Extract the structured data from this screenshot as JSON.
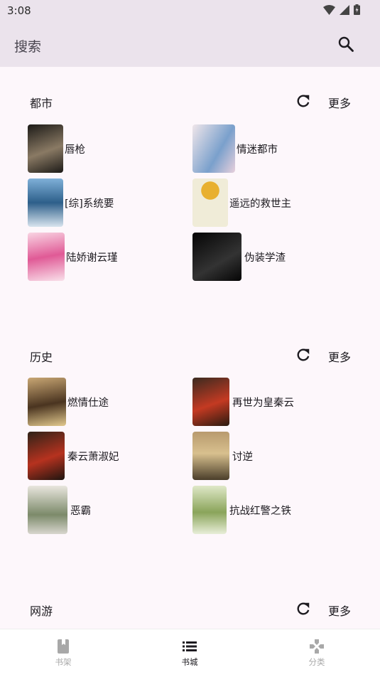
{
  "status": {
    "time": "3:08"
  },
  "appbar": {
    "search_label": "搜索"
  },
  "sections": [
    {
      "title": "都市",
      "more": "更多",
      "books": [
        {
          "title": "唇枪",
          "cover": [
            "#1c1a17",
            "#8a7a64"
          ]
        },
        {
          "title": "情迷都市",
          "cover": [
            "#f0e6ea",
            "#7aa0cc"
          ]
        },
        {
          "title": "[综]系统要",
          "cover": [
            "#2d5f8a",
            "#d8e4ee"
          ]
        },
        {
          "title": "遥远的救世主",
          "cover": [
            "#f0ecd8",
            "#e8b030"
          ]
        },
        {
          "title": "陆娇谢云瑾",
          "cover": [
            "#f9d5e3",
            "#e05a96"
          ]
        },
        {
          "title": "伪装学渣",
          "cover": [
            "#050505",
            "#333333"
          ]
        }
      ]
    },
    {
      "title": "历史",
      "more": "更多",
      "books": [
        {
          "title": "燃情仕途",
          "cover": [
            "#c9a774",
            "#4a3420"
          ]
        },
        {
          "title": "再世为皇秦云",
          "cover": [
            "#3a2a20",
            "#c43a22"
          ]
        },
        {
          "title": "秦云萧淑妃",
          "cover": [
            "#2e2318",
            "#b6321f"
          ]
        },
        {
          "title": "讨逆",
          "cover": [
            "#b89a6e",
            "#4a3e2a"
          ]
        },
        {
          "title": "恶霸",
          "cover": [
            "#e9e6de",
            "#7c8a6a"
          ]
        },
        {
          "title": "抗战红警之铁",
          "cover": [
            "#dfe8c8",
            "#8aa45a"
          ]
        }
      ]
    },
    {
      "title": "网游",
      "more": "更多",
      "books": []
    }
  ],
  "bottom_nav": [
    {
      "label": "书架",
      "color": "#a8a8a8"
    },
    {
      "label": "书城",
      "color": "#1d1b20"
    },
    {
      "label": "分类",
      "color": "#a8a8a8"
    }
  ]
}
